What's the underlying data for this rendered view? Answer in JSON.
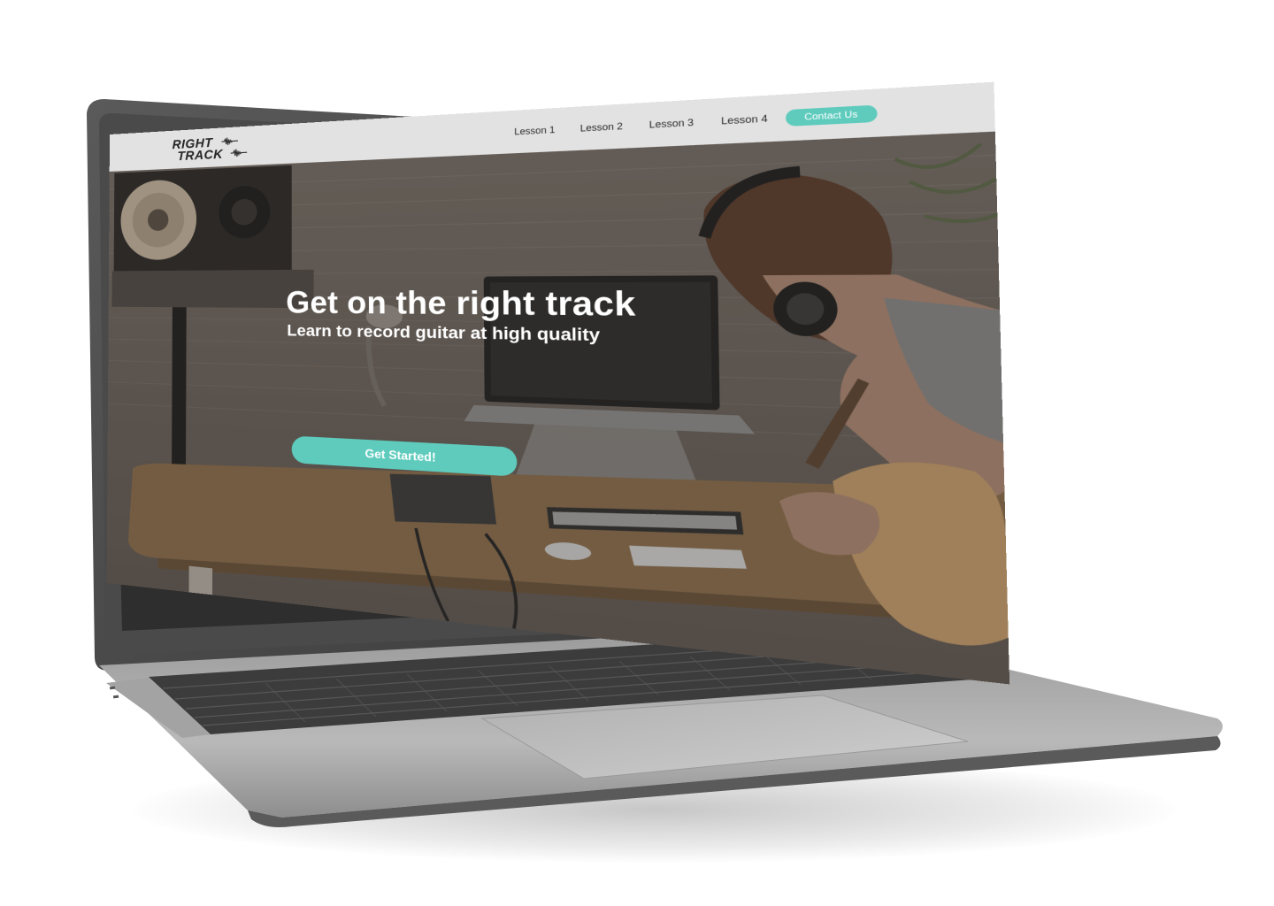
{
  "site": {
    "logo": {
      "line1": "RIGHT",
      "line2": "TRACK"
    },
    "nav": {
      "links": [
        "Lesson 1",
        "Lesson 2",
        "Lesson 3",
        "Lesson 4"
      ],
      "contact_label": "Contact Us"
    },
    "hero": {
      "title": "Get on the right track",
      "subtitle": "Learn to record guitar at high quality",
      "cta_label": "Get Started!"
    }
  },
  "colors": {
    "accent": "#5ecbbd",
    "nav_background": "#e2e2e2",
    "laptop_body": "#8e8e8e",
    "bezel": "#4a4a4a"
  }
}
